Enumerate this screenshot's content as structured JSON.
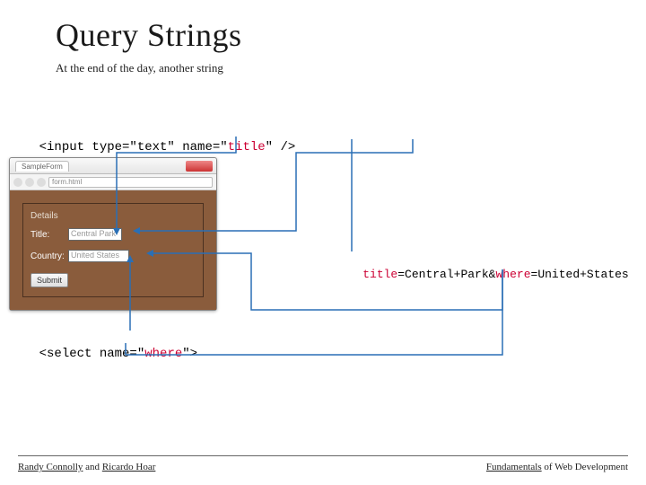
{
  "title": "Query Strings",
  "subtitle": "At the end of the day, another string",
  "code": {
    "input": {
      "pre": "<input type=\"text\" name=\"",
      "name": "title",
      "post": "\" />"
    },
    "select": {
      "pre": "<select name=\"",
      "name": "where",
      "post": "\">"
    }
  },
  "browser": {
    "tab": "SampleForm",
    "url": "form.html",
    "legend": "Details",
    "title_label": "Title:",
    "title_value": "Central Park",
    "country_label": "Country:",
    "country_value": "United States",
    "submit": "Submit"
  },
  "query": {
    "k1": "title",
    "eq": "=",
    "v1": "Central+Park",
    "amp": "&",
    "k2": "where",
    "v2": "United+States"
  },
  "footer": {
    "left_a": "Randy Connolly",
    "left_mid": " and ",
    "left_b": "Ricardo Hoar",
    "right_a": "Fundamentals",
    "right_b": " of Web Development"
  }
}
